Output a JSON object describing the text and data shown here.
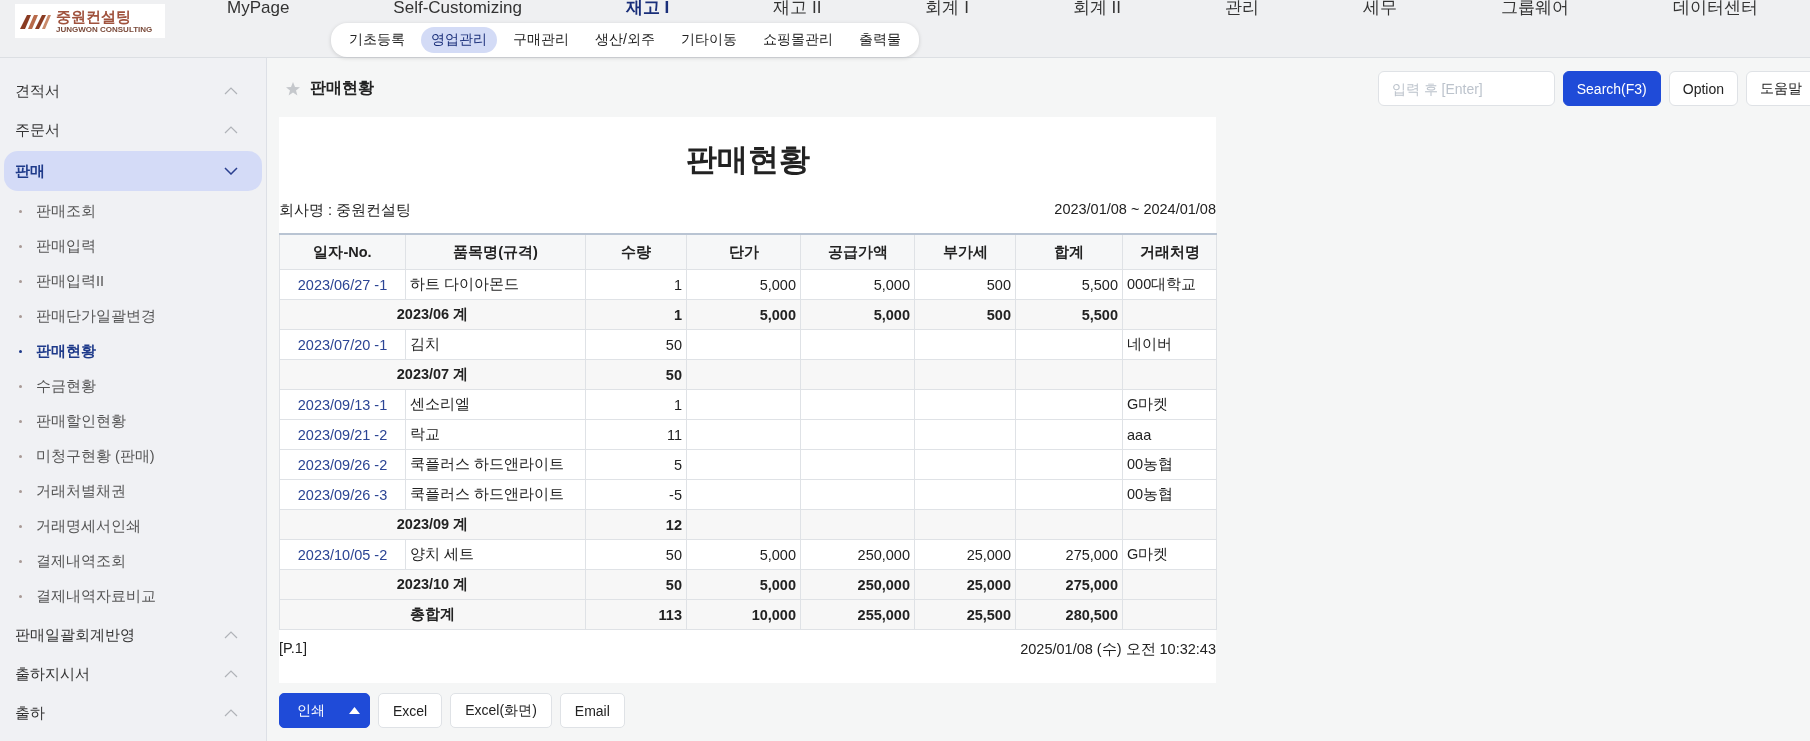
{
  "logo": {
    "name": "중원컨설팅",
    "tagline": "JUNGWON CONSULTING"
  },
  "top_menu": [
    {
      "label": "MyPage",
      "selected": false
    },
    {
      "label": "Self-Customizing",
      "selected": false
    },
    {
      "label": "재고 I",
      "selected": true
    },
    {
      "label": "재고 II",
      "selected": false
    },
    {
      "label": "회계 I",
      "selected": false
    },
    {
      "label": "회계 II",
      "selected": false
    },
    {
      "label": "관리",
      "selected": false
    },
    {
      "label": "세무",
      "selected": false
    },
    {
      "label": "그룹웨어",
      "selected": false
    },
    {
      "label": "데이터센터",
      "selected": false
    }
  ],
  "sub_menu": [
    {
      "label": "기초등록",
      "selected": false
    },
    {
      "label": "영업관리",
      "selected": true
    },
    {
      "label": "구매관리",
      "selected": false
    },
    {
      "label": "생산/외주",
      "selected": false
    },
    {
      "label": "기타이동",
      "selected": false
    },
    {
      "label": "쇼핑몰관리",
      "selected": false
    },
    {
      "label": "출력물",
      "selected": false
    }
  ],
  "sidebar": {
    "items": [
      {
        "label": "견적서",
        "expanded": false,
        "selected": false
      },
      {
        "label": "주문서",
        "expanded": false,
        "selected": false
      },
      {
        "label": "판매",
        "expanded": true,
        "selected": true,
        "children": [
          {
            "label": "판매조회",
            "selected": false
          },
          {
            "label": "판매입력",
            "selected": false
          },
          {
            "label": "판매입력II",
            "selected": false
          },
          {
            "label": "판매단가일괄변경",
            "selected": false
          },
          {
            "label": "판매현황",
            "selected": true
          },
          {
            "label": "수금현황",
            "selected": false
          },
          {
            "label": "판매할인현황",
            "selected": false
          },
          {
            "label": "미청구현황 (판매)",
            "selected": false
          },
          {
            "label": "거래처별채권",
            "selected": false
          },
          {
            "label": "거래명세서인쇄",
            "selected": false
          },
          {
            "label": "결제내역조회",
            "selected": false
          },
          {
            "label": "결제내역자료비교",
            "selected": false
          }
        ]
      },
      {
        "label": "판매일괄회계반영",
        "expanded": false,
        "selected": false
      },
      {
        "label": "출하지시서",
        "expanded": false,
        "selected": false
      },
      {
        "label": "출하",
        "expanded": false,
        "selected": false
      }
    ]
  },
  "page": {
    "title": "판매현황",
    "favorite": false
  },
  "search": {
    "placeholder": "입력 후 [Enter]"
  },
  "toolbar_buttons": [
    {
      "label": "Search(F3)",
      "kind": "primary"
    },
    {
      "label": "Option",
      "kind": "default"
    },
    {
      "label": "도움말",
      "kind": "default"
    }
  ],
  "report": {
    "title": "판매현황",
    "company": "회사명 : 중원컨설팅",
    "period": "2023/01/08 ~ 2024/01/08",
    "table": {
      "columns": [
        "일자-No.",
        "품목명(규격)",
        "수량",
        "단가",
        "공급가액",
        "부가세",
        "합계",
        "거래처명"
      ],
      "rows": [
        {
          "kind": "item",
          "date_no": "2023/06/27 -1",
          "item": "하트 다이아몬드",
          "qty": "1",
          "price": "5,000",
          "supply": "5,000",
          "vat": "500",
          "total": "5,500",
          "customer": "000대학교"
        },
        {
          "kind": "subtotal",
          "label": "2023/06 계",
          "qty": "1",
          "price": "5,000",
          "supply": "5,000",
          "vat": "500",
          "total": "5,500"
        },
        {
          "kind": "item",
          "date_no": "2023/07/20 -1",
          "item": "김치",
          "qty": "50",
          "customer": "네이버"
        },
        {
          "kind": "subtotal",
          "label": "2023/07 계",
          "qty": "50"
        },
        {
          "kind": "item",
          "date_no": "2023/09/13 -1",
          "item": "센소리엘",
          "qty": "1",
          "customer": "G마켓"
        },
        {
          "kind": "item",
          "date_no": "2023/09/21 -2",
          "item": "락교",
          "qty": "11",
          "customer": "aaa"
        },
        {
          "kind": "item",
          "date_no": "2023/09/26 -2",
          "item": "쿡플러스 하드앤라이트",
          "qty": "5",
          "customer": "00농협"
        },
        {
          "kind": "item",
          "date_no": "2023/09/26 -3",
          "item": "쿡플러스 하드앤라이트",
          "qty": "-5",
          "customer": "00농협"
        },
        {
          "kind": "subtotal",
          "label": "2023/09 계",
          "qty": "12"
        },
        {
          "kind": "item",
          "date_no": "2023/10/05 -2",
          "item": "양치 세트",
          "qty": "50",
          "price": "5,000",
          "supply": "250,000",
          "vat": "25,000",
          "total": "275,000",
          "customer": "G마켓"
        },
        {
          "kind": "subtotal",
          "label": "2023/10 계",
          "qty": "50",
          "price": "5,000",
          "supply": "250,000",
          "vat": "25,000",
          "total": "275,000"
        },
        {
          "kind": "total",
          "label": "총합계",
          "qty": "113",
          "price": "10,000",
          "supply": "255,000",
          "vat": "25,500",
          "total": "280,500"
        }
      ]
    },
    "page_no": "[P.1]",
    "printed_at": "2025/01/08 (수) 오전 10:32:43"
  },
  "bottom_buttons": [
    {
      "label": "인쇄",
      "kind": "split"
    },
    {
      "label": "Excel",
      "kind": "default"
    },
    {
      "label": "Excel(화면)",
      "kind": "default"
    },
    {
      "label": "Email",
      "kind": "default"
    }
  ]
}
